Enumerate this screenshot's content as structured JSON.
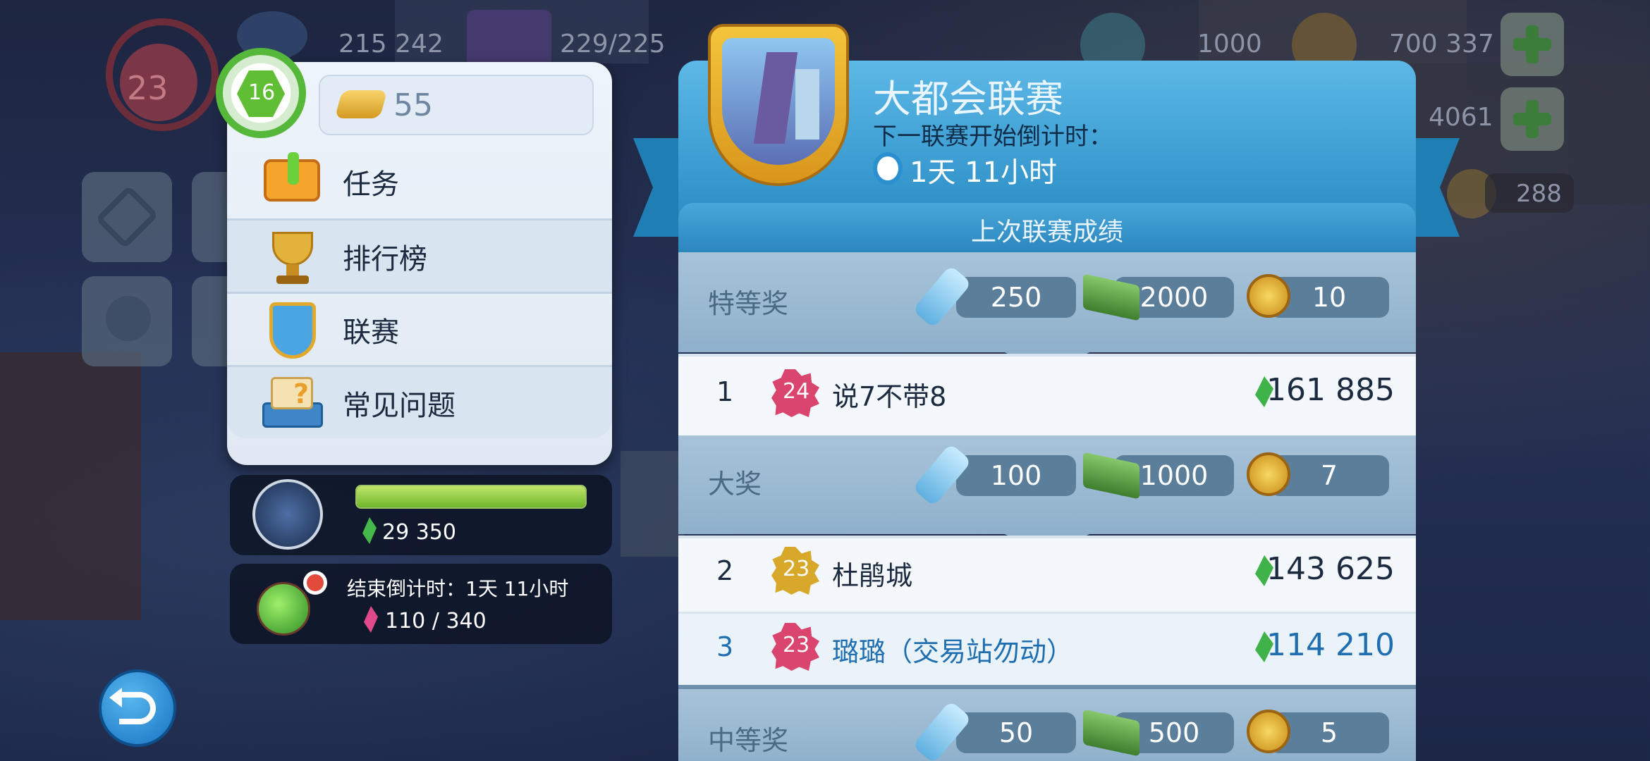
{
  "hud": {
    "population": "215 242",
    "storage": "229/225",
    "player_level": "23",
    "neo_simoleons": "1000",
    "simoleons": "700 337",
    "simcash": "4061",
    "keys": "288"
  },
  "menu": {
    "player_level_badge": "16",
    "golden_bolts": "55",
    "items": [
      {
        "label": "任务",
        "icon": "task-icon"
      },
      {
        "label": "排行榜",
        "icon": "trophy-icon"
      },
      {
        "label": "联赛",
        "icon": "league-shield-icon"
      },
      {
        "label": "常见问题",
        "icon": "faq-book-icon"
      }
    ]
  },
  "events": {
    "contest": {
      "points": "29 350",
      "progress": 1.0
    },
    "season": {
      "countdown": "结束倒计时：1天 11小时",
      "progress": "110 / 340"
    }
  },
  "league": {
    "title": "大都会联赛",
    "subtitle": "下一联赛开始倒计时：",
    "countdown": "1天 11小时",
    "last_results": "上次联赛成绩",
    "tiers": [
      {
        "label": "特等奖",
        "keys": "250",
        "cash": "2000",
        "medals": "10"
      },
      {
        "label": "大奖",
        "keys": "100",
        "cash": "1000",
        "medals": "7"
      },
      {
        "label": "中等奖",
        "keys": "50",
        "cash": "500",
        "medals": "5"
      }
    ],
    "players": [
      {
        "rank": "1",
        "level": "24",
        "name": "说7不带8",
        "score": "161 885"
      },
      {
        "rank": "2",
        "level": "23",
        "name": "杜鹃城",
        "score": "143 625"
      },
      {
        "rank": "3",
        "level": "23",
        "name": "璐璐（交易站勿动）",
        "score": "114 210"
      }
    ]
  },
  "colors": {
    "accent_blue": "#2d8fc7",
    "highlight_rank": "#1f6fb0",
    "gem_green": "#3fb24a"
  }
}
